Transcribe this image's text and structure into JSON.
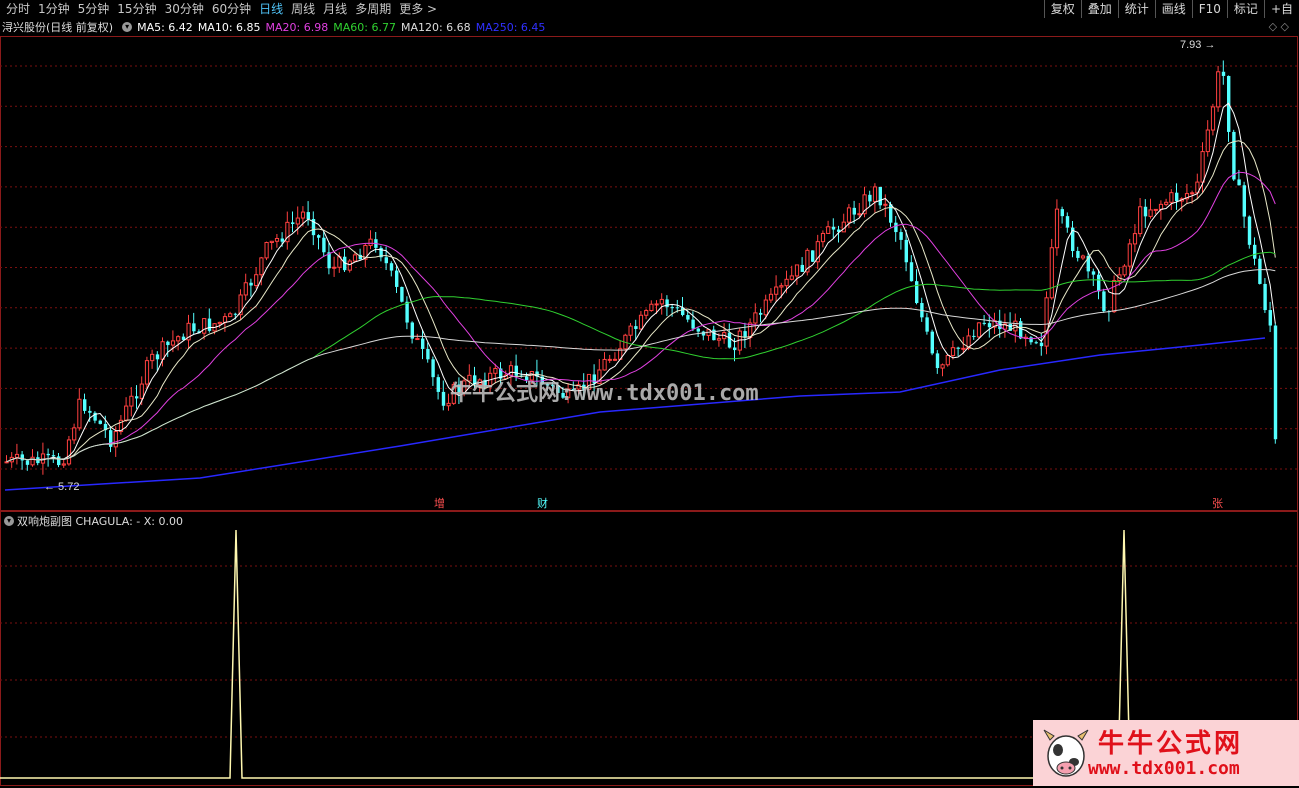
{
  "toolbar": {
    "left_items": [
      "分时",
      "1分钟",
      "5分钟",
      "15分钟",
      "30分钟",
      "60分钟",
      "日线",
      "周线",
      "月线",
      "多周期",
      "更多 >"
    ],
    "active": "日线",
    "right_items": [
      "复权",
      "叠加",
      "统计",
      "画线",
      "F10",
      "标记",
      "+自"
    ]
  },
  "legend": {
    "stock": "浔兴股份(日线 前复权)",
    "ma5": "MA5: 6.42",
    "ma10": "MA10: 6.85",
    "ma20": "MA20: 6.98",
    "ma60": "MA60: 6.77",
    "ma120": "MA120: 6.68",
    "ma250": "MA250: 6.45",
    "colors": {
      "ma5": "#ffffff",
      "ma10": "#ffffff",
      "ma20": "#e040e0",
      "ma60": "#30d030",
      "ma120": "#ffffff",
      "ma250": "#2828ff"
    }
  },
  "price": {
    "high_label": "7.93",
    "low_label": "5.72",
    "watermark": "牛牛公式网:www.tdx001.com"
  },
  "markers": [
    "增",
    "财",
    "张"
  ],
  "indicator": {
    "legend": "双响炮副图  CHAGULA: -  X: 0.00",
    "spikes": 2
  },
  "logo": {
    "title": "牛牛公式网",
    "url": "www.tdx001.com"
  }
}
